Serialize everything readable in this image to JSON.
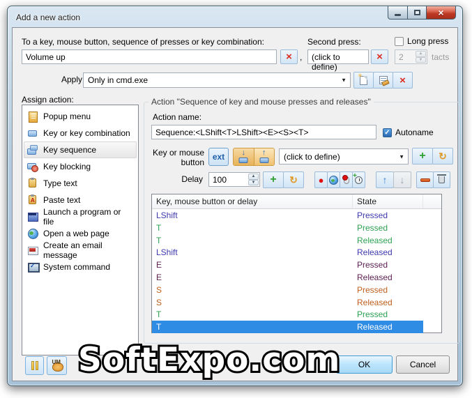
{
  "window": {
    "title": "Add a new action"
  },
  "icons": {
    "delete": "×",
    "add": "+",
    "replace": "↻",
    "record": "●",
    "move_up": "↑",
    "move_down": "↓",
    "key_down": "↓",
    "key_up": "↑",
    "dropdown_arrow": "▼",
    "spinner_up": "▲",
    "spinner_down": "▼",
    "check": "✓",
    "close_x": "×"
  },
  "top": {
    "assign_label": "To a key, mouse button, sequence of presses or key combination:",
    "key_value": "Volume up",
    "comma": ",",
    "second_press_label": "Second press:",
    "second_press_value": "(click to define)",
    "long_press_label": "Long press",
    "tacts_value": "2",
    "tacts_label": "tacts",
    "apply_label": "Apply",
    "apply_value": "Only in cmd.exe"
  },
  "sidebar": {
    "label": "Assign action:",
    "items": [
      {
        "label": "Popup menu",
        "icon": "popup-menu",
        "selected": false
      },
      {
        "label": "Key or key combination",
        "icon": "key-combination",
        "selected": false
      },
      {
        "label": "Key sequence",
        "icon": "key-sequence",
        "selected": true
      },
      {
        "label": "Key blocking",
        "icon": "key-blocking",
        "selected": false
      },
      {
        "label": "Type text",
        "icon": "type-text",
        "selected": false
      },
      {
        "label": "Paste text",
        "icon": "paste-text",
        "selected": false
      },
      {
        "label": "Launch a program or file",
        "icon": "launch-program",
        "selected": false
      },
      {
        "label": "Open a web page",
        "icon": "open-web-page",
        "selected": false
      },
      {
        "label": "Create an email message",
        "icon": "email-message",
        "selected": false
      },
      {
        "label": "System command",
        "icon": "system-command",
        "selected": false
      }
    ]
  },
  "panel": {
    "group_title": "Action \"Sequence of key and mouse presses and releases\"",
    "action_name_label": "Action name:",
    "action_name_value": "Sequence:<LShift<T>LShift><E><S><T>",
    "autoname_label": "Autoname",
    "key_or_mouse_line1": "Key or mouse",
    "key_or_mouse_line2": "button",
    "ext_label": "ext",
    "key_dropdown_value": "(click to define)",
    "delay_label": "Delay",
    "delay_value": "100",
    "table": {
      "columns": [
        "Key, mouse button or delay",
        "State"
      ],
      "rows": [
        {
          "key": "LShift",
          "state": "Pressed",
          "color": "#3d39ae",
          "selected": false
        },
        {
          "key": "T",
          "state": "Pressed",
          "color": "#2ea152",
          "selected": false
        },
        {
          "key": "T",
          "state": "Released",
          "color": "#2ea152",
          "selected": false
        },
        {
          "key": "LShift",
          "state": "Released",
          "color": "#3d39ae",
          "selected": false
        },
        {
          "key": "E",
          "state": "Pressed",
          "color": "#5e2154",
          "selected": false
        },
        {
          "key": "E",
          "state": "Released",
          "color": "#5e2154",
          "selected": false
        },
        {
          "key": "S",
          "state": "Pressed",
          "color": "#c05f1e",
          "selected": false
        },
        {
          "key": "S",
          "state": "Released",
          "color": "#c05f1e",
          "selected": false
        },
        {
          "key": "T",
          "state": "Pressed",
          "color": "#2ea152",
          "selected": false
        },
        {
          "key": "T",
          "state": "Released",
          "color": "#ffffff",
          "selected": true
        }
      ]
    }
  },
  "footer": {
    "ok_label": "OK",
    "cancel_label": "Cancel",
    "um_label": "UM"
  },
  "watermark": {
    "text": "SoftExpo.com"
  },
  "colors": {
    "selection": "#2f8ce4",
    "selection_text": "#ffffff",
    "dialog_bg": "#f0f0f0",
    "frame": "#aec8dd",
    "close_button": "#bc3823",
    "delete_x": "#dd2c1d",
    "add_green": "#2e9e2e"
  }
}
